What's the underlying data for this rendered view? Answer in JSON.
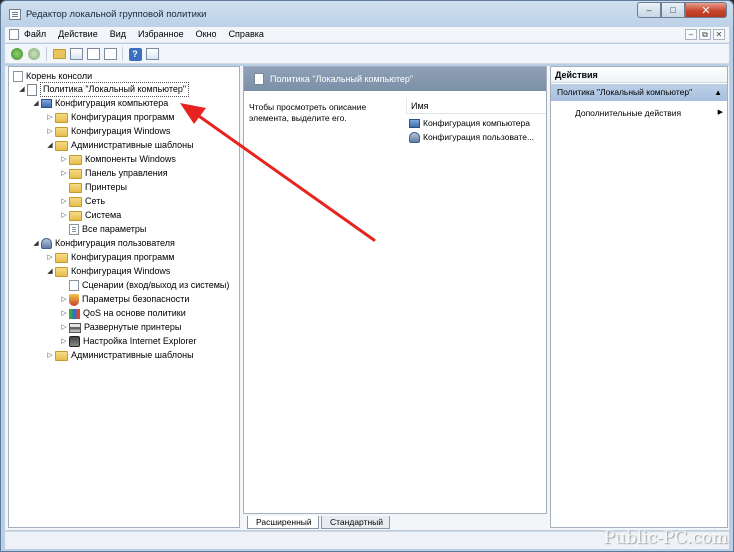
{
  "window": {
    "title": "Редактор локальной групповой политики",
    "controls": {
      "minimize": "–",
      "maximize": "□",
      "close": "✕"
    }
  },
  "menu": {
    "items": [
      "Файл",
      "Действие",
      "Вид",
      "Избранное",
      "Окно",
      "Справка"
    ],
    "mdi_controls": [
      "–",
      "⧉",
      "✕"
    ]
  },
  "toolbar": {
    "buttons": [
      "back-icon",
      "forward-icon",
      "up-folder-icon",
      "show-hide-tree-icon",
      "properties-icon",
      "export-list-icon",
      "help-icon",
      "show-hide-action-pane-icon"
    ]
  },
  "tree": {
    "root": "Корень консоли",
    "policy": "Политика \"Локальный компьютер\"",
    "computer_config": "Конфигурация компьютера",
    "items": [
      "Конфигурация программ",
      "Конфигурация Windows",
      "Административные шаблоны",
      "Компоненты Windows",
      "Панель управления",
      "Принтеры",
      "Сеть",
      "Система",
      "Все параметры",
      "Конфигурация пользователя",
      "Конфигурация программ",
      "Конфигурация Windows",
      "Сценарии (вход/выход из системы)",
      "Параметры безопасности",
      "QoS на основе политики",
      "Развернутые принтеры",
      "Настройка Internet Explorer",
      "Административные шаблоны"
    ]
  },
  "middle": {
    "header": "Политика \"Локальный компьютер\"",
    "description": "Чтобы просмотреть описание элемента, выделите его.",
    "column": "Имя",
    "rows": [
      "Конфигурация компьютера",
      "Конфигурация пользовате..."
    ],
    "tabs": [
      "Расширенный",
      "Стандартный"
    ]
  },
  "actions": {
    "title": "Действия",
    "section": "Политика \"Локальный компьютер\"",
    "item": "Дополнительные действия"
  },
  "watermark": "Public-PC.com",
  "colors": {
    "arrow": "#e8231f",
    "header_band": "#7b8fa6",
    "action_selected": "#b0c6e2"
  }
}
